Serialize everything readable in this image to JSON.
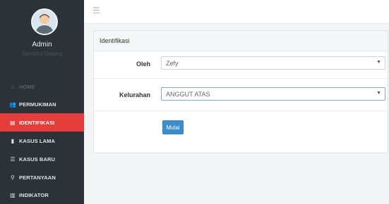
{
  "profile": {
    "name": "Admin",
    "role": "Senarlut Datang"
  },
  "menu_icon": "hamburger-icon",
  "nav": [
    {
      "label": "HOME",
      "icon": "home-icon",
      "glyph": "⌂"
    },
    {
      "label": "PERMUKIMAN",
      "icon": "people-icon",
      "glyph": "👥"
    },
    {
      "label": "IDENTIFIKASI",
      "icon": "book-icon",
      "glyph": "▤"
    },
    {
      "label": "KASUS LAMA",
      "icon": "bookmark-icon",
      "glyph": "▮"
    },
    {
      "label": "KASUS BARU",
      "icon": "list-icon",
      "glyph": "☰"
    },
    {
      "label": "PERTANYAAN",
      "icon": "question-icon",
      "glyph": "⚲"
    },
    {
      "label": "INDIKATOR",
      "icon": "bar-chart-icon",
      "glyph": "▥"
    }
  ],
  "panel": {
    "title": "Identifikasi",
    "oleh_label": "Oleh",
    "oleh_value": "Zefy",
    "kelurahan_label": "Kelurahan",
    "kelurahan_value": "ANGGUT ATAS",
    "button": "Mulai"
  },
  "colors": {
    "sidebar": "#2c3238",
    "active": "#e43d3a",
    "button": "#3c8dcc"
  }
}
